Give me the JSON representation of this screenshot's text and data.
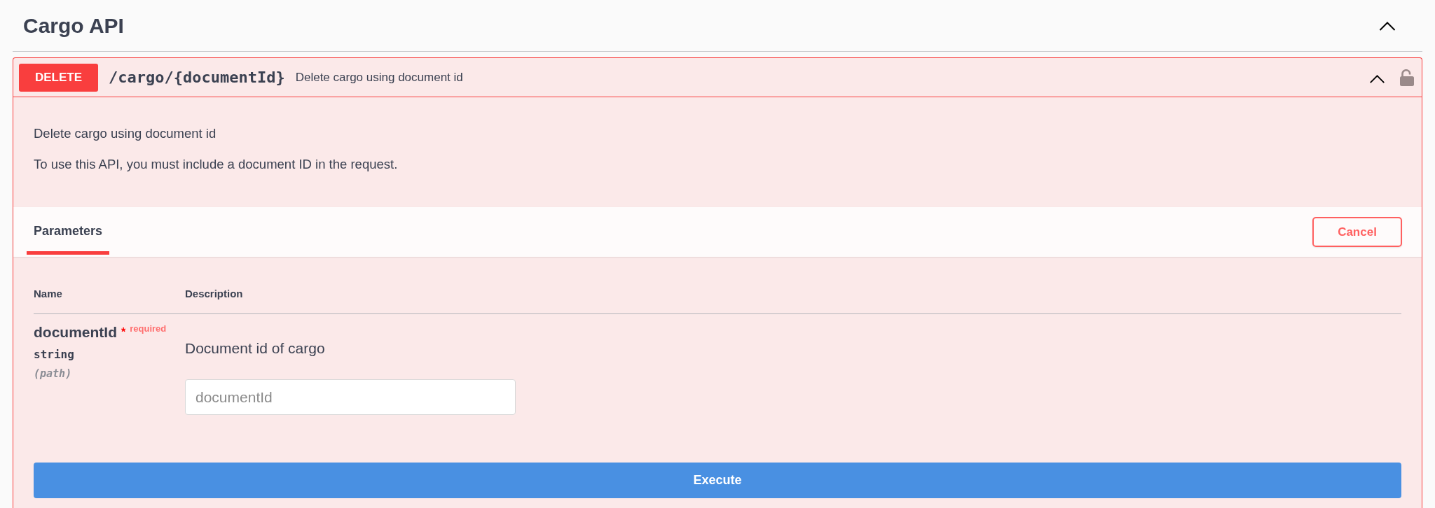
{
  "section": {
    "title": "Cargo API",
    "expanded": true
  },
  "operation": {
    "method": "DELETE",
    "path": "/cargo/{documentId}",
    "summary": "Delete cargo using document id",
    "expanded": true,
    "locked": false,
    "description": [
      "Delete cargo using document id",
      "To use this API, you must include a document ID in the request."
    ],
    "tabs": [
      {
        "label": "Parameters",
        "selected": true
      }
    ],
    "cancel_button": "Cancel",
    "parameters": {
      "columns": [
        "Name",
        "Description"
      ],
      "rows": [
        {
          "name": "documentId",
          "required": true,
          "required_mark": "*",
          "required_label": "required",
          "type": "string",
          "location": "(path)",
          "description": "Document id of cargo",
          "input": {
            "placeholder": "documentId"
          }
        }
      ]
    },
    "execute_button": "Execute"
  }
}
